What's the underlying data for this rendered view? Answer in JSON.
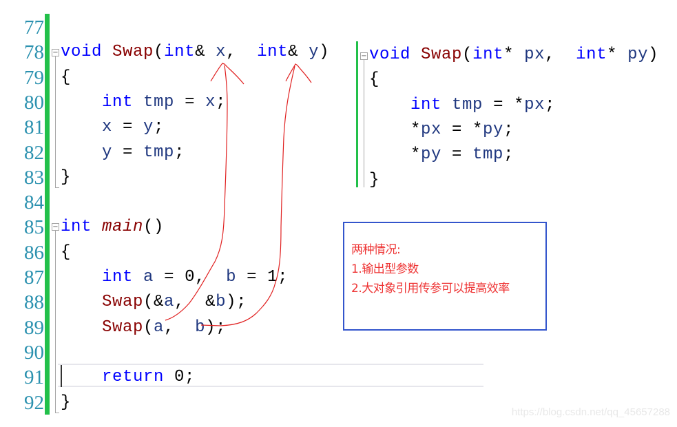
{
  "editor": {
    "line_numbers": [
      "77",
      "78",
      "79",
      "80",
      "81",
      "82",
      "83",
      "84",
      "85",
      "86",
      "87",
      "88",
      "89",
      "90",
      "91",
      "92"
    ],
    "left_code": [
      [],
      [
        [
          "kw",
          "void"
        ],
        [
          "pn",
          " "
        ],
        [
          "fn",
          "Swap"
        ],
        [
          "pn",
          "("
        ],
        [
          "kw",
          "int"
        ],
        [
          "pn",
          "& "
        ],
        [
          "var",
          "x"
        ],
        [
          "pn",
          ",  "
        ],
        [
          "kw",
          "int"
        ],
        [
          "pn",
          "& "
        ],
        [
          "var",
          "y"
        ],
        [
          "pn",
          ")"
        ]
      ],
      [
        [
          "pn",
          "{"
        ]
      ],
      [
        [
          "pn",
          "    "
        ],
        [
          "kw",
          "int"
        ],
        [
          "pn",
          " "
        ],
        [
          "var",
          "tmp"
        ],
        [
          "pn",
          " = "
        ],
        [
          "var",
          "x"
        ],
        [
          "pn",
          ";"
        ]
      ],
      [
        [
          "pn",
          "    "
        ],
        [
          "var",
          "x"
        ],
        [
          "pn",
          " = "
        ],
        [
          "var",
          "y"
        ],
        [
          "pn",
          ";"
        ]
      ],
      [
        [
          "pn",
          "    "
        ],
        [
          "var",
          "y"
        ],
        [
          "pn",
          " = "
        ],
        [
          "var",
          "tmp"
        ],
        [
          "pn",
          ";"
        ]
      ],
      [
        [
          "pn",
          "}"
        ]
      ],
      [],
      [
        [
          "kw",
          "int"
        ],
        [
          "pn",
          " "
        ],
        [
          "fn-it",
          "main"
        ],
        [
          "pn",
          "()"
        ]
      ],
      [
        [
          "pn",
          "{"
        ]
      ],
      [
        [
          "pn",
          "    "
        ],
        [
          "kw",
          "int"
        ],
        [
          "pn",
          " "
        ],
        [
          "var",
          "a"
        ],
        [
          "pn",
          " = 0,  "
        ],
        [
          "var",
          "b"
        ],
        [
          "pn",
          " = 1;"
        ]
      ],
      [
        [
          "pn",
          "    "
        ],
        [
          "fn",
          "Swap"
        ],
        [
          "pn",
          "(&"
        ],
        [
          "var",
          "a"
        ],
        [
          "pn",
          ",  &"
        ],
        [
          "var",
          "b"
        ],
        [
          "pn",
          ");"
        ]
      ],
      [
        [
          "pn",
          "    "
        ],
        [
          "fn",
          "Swap"
        ],
        [
          "pn",
          "("
        ],
        [
          "var",
          "a"
        ],
        [
          "pn",
          ",  "
        ],
        [
          "var",
          "b"
        ],
        [
          "pn",
          ");"
        ]
      ],
      [],
      [
        [
          "pn",
          "    "
        ],
        [
          "kw",
          "return"
        ],
        [
          "pn",
          " 0;"
        ]
      ],
      [
        [
          "pn",
          "}"
        ]
      ]
    ],
    "right_code": [
      [
        [
          "kw",
          "void"
        ],
        [
          "pn",
          " "
        ],
        [
          "fn",
          "Swap"
        ],
        [
          "pn",
          "("
        ],
        [
          "kw",
          "int"
        ],
        [
          "pn",
          "* "
        ],
        [
          "var",
          "px"
        ],
        [
          "pn",
          ",  "
        ],
        [
          "kw",
          "int"
        ],
        [
          "pn",
          "* "
        ],
        [
          "var",
          "py"
        ],
        [
          "pn",
          ")"
        ]
      ],
      [
        [
          "pn",
          "{"
        ]
      ],
      [
        [
          "pn",
          "    "
        ],
        [
          "kw",
          "int"
        ],
        [
          "pn",
          " "
        ],
        [
          "var",
          "tmp"
        ],
        [
          "pn",
          " = *"
        ],
        [
          "var",
          "px"
        ],
        [
          "pn",
          ";"
        ]
      ],
      [
        [
          "pn",
          "    *"
        ],
        [
          "var",
          "px"
        ],
        [
          "pn",
          " = *"
        ],
        [
          "var",
          "py"
        ],
        [
          "pn",
          ";"
        ]
      ],
      [
        [
          "pn",
          "    *"
        ],
        [
          "var",
          "py"
        ],
        [
          "pn",
          " = "
        ],
        [
          "var",
          "tmp"
        ],
        [
          "pn",
          ";"
        ]
      ],
      [
        [
          "pn",
          "}"
        ]
      ]
    ],
    "current_line": "91",
    "colors": {
      "gutter_bar": "#22c04a",
      "line_number": "#2b91af",
      "keyword": "#0000ff",
      "function": "#880000",
      "variable": "#1f377f",
      "annotation": "#e02020",
      "note_border": "#3355cc",
      "note_text": "#ee3333"
    }
  },
  "note": {
    "title": "两种情况:",
    "item1": "1.输出型参数",
    "item2": "2.大对象引用传参可以提高效率"
  },
  "watermark": "https://blog.csdn.net/qq_45657288"
}
